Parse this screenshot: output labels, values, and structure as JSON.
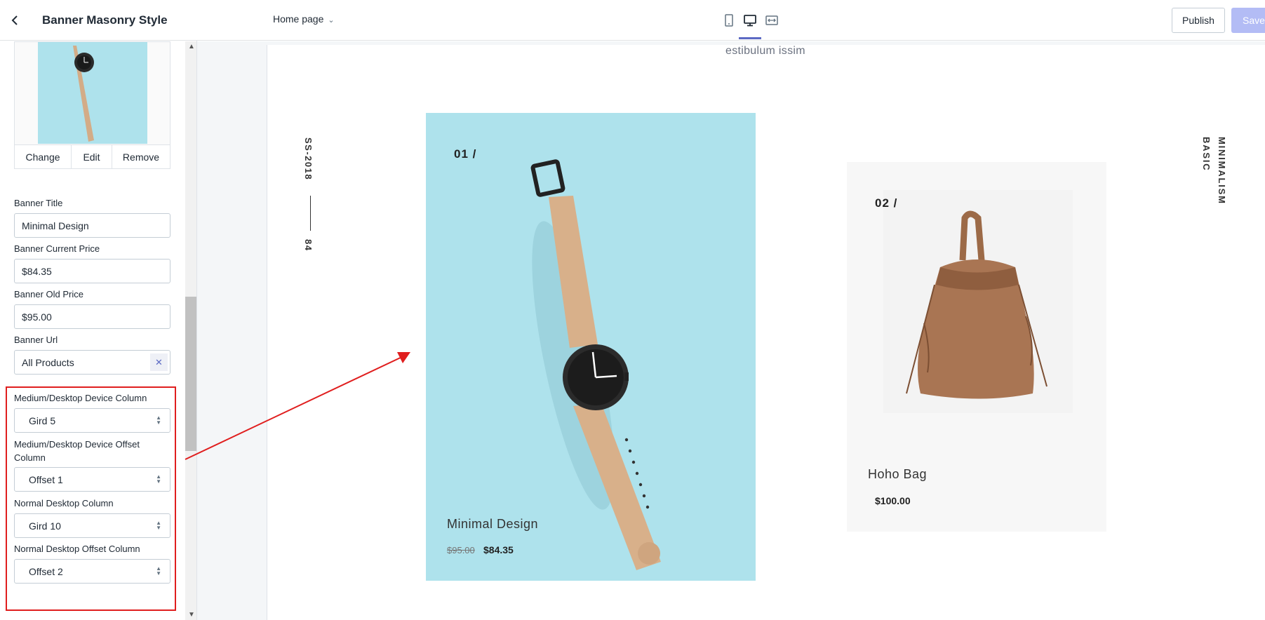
{
  "sidebar": {
    "title": "Banner Masonry Style",
    "image_actions": {
      "change": "Change",
      "edit": "Edit",
      "remove": "Remove"
    },
    "fields": {
      "banner_title": {
        "label": "Banner Title",
        "value": "Minimal Design"
      },
      "banner_current_price": {
        "label": "Banner Current Price",
        "value": "$84.35"
      },
      "banner_old_price": {
        "label": "Banner Old Price",
        "value": "$95.00"
      },
      "banner_url": {
        "label": "Banner Url",
        "value": "All Products"
      },
      "md_column": {
        "label": "Medium/Desktop Device Column",
        "value": "Gird 5"
      },
      "md_offset": {
        "label_line1": "Medium/Desktop Device Offset",
        "label_line2": "Column",
        "value": "Offset 1"
      },
      "nd_column": {
        "label": "Normal Desktop Column",
        "value": "Gird 10"
      },
      "nd_offset": {
        "label": "Normal Desktop Offset Column",
        "value": "Offset 2"
      }
    }
  },
  "topbar": {
    "page_select": "Home page",
    "publish": "Publish",
    "save": "Save",
    "device_icons": [
      "mobile-icon",
      "desktop-icon",
      "fullwidth-icon"
    ],
    "active_device": "desktop-icon"
  },
  "canvas": {
    "header_text": "estibulum issim",
    "vertical_left_top": "SS-2018",
    "vertical_left_bottom": "84",
    "vertical_right_line1": "BASIC",
    "vertical_right_line2": "MINIMALISM",
    "banner1": {
      "number": "01 /",
      "title": "Minimal Design",
      "old_price": "$95.00",
      "current_price": "$84.35"
    },
    "banner2": {
      "number": "02 /",
      "title": "Hoho Bag",
      "current_price": "$100.00"
    }
  },
  "colors": {
    "accent": "#5c6ac4",
    "save_disabled": "#b3bcf5",
    "highlight": "#e01e1e",
    "banner1_bg": "#aee2ec",
    "banner2_bg": "#f7f7f7"
  }
}
